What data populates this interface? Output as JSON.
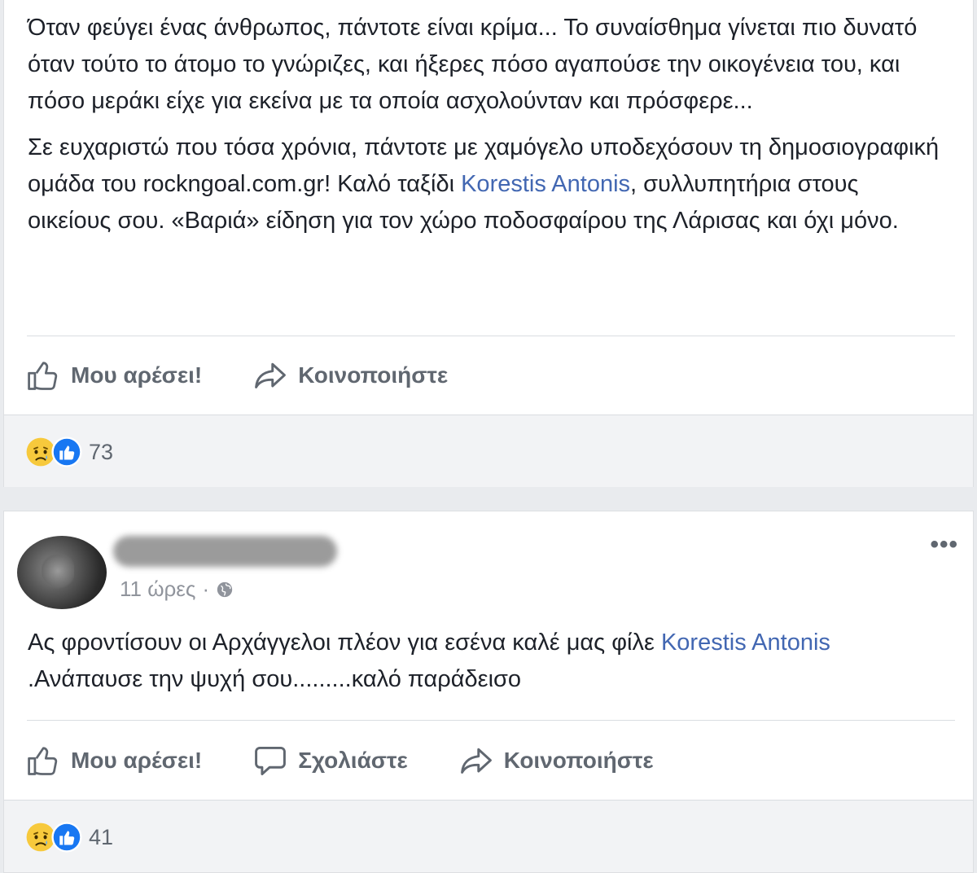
{
  "post1": {
    "paragraph1": "Όταν φεύγει ένας άνθρωπος, πάντοτε είναι κρίμα... Το συναίσθημα γίνεται πιο δυνατό όταν τούτο το άτομο το γνώριζες, και ήξερες πόσο αγαπούσε την οικογένεια του, και πόσο μεράκι είχε για εκείνα με τα οποία ασχολούνταν και πρόσφερε...",
    "paragraph2_before": "Σε ευχαριστώ που τόσα χρόνια, πάντοτε με χαμόγελο υποδεχόσουν τη δημοσιογραφική ομάδα του rockngoal.com.gr! Καλό ταξίδι ",
    "mention": "Korestis Antonis",
    "paragraph2_after": ", συλλυπητήρια στους οικείους σου. «Βαριά» είδηση για τον χώρο ποδοσφαίρου της Λάρισας και όχι μόνο.",
    "actions": {
      "like": "Μου αρέσει!",
      "share": "Κοινοποιήστε"
    },
    "reaction_count": "73"
  },
  "post2": {
    "time": "11 ώρες",
    "separator": "·",
    "more": "•••",
    "text_before": "Ας φροντίσουν οι Αρχάγγελοι πλέον για εσένα καλέ μας φίλε ",
    "mention": "Korestis Antonis",
    "text_after": ".Ανάπαυσε την ψυχή σου.........καλό παράδεισο",
    "actions": {
      "like": "Μου αρέσει!",
      "comment": "Σχολιάστε",
      "share": "Κοινοποιήστε"
    },
    "reaction_count": "41"
  },
  "icons": {
    "like": "thumbs-up-icon",
    "comment": "comment-icon",
    "share": "share-arrow-icon",
    "sad": "sad-reaction-icon",
    "like_reaction": "like-reaction-icon",
    "privacy": "globe-icon"
  },
  "colors": {
    "mention": "#4267b2",
    "action_text": "#606770",
    "meta_text": "#90949c",
    "like_blue": "#1877f2",
    "sad_yellow": "#f7c93c"
  }
}
